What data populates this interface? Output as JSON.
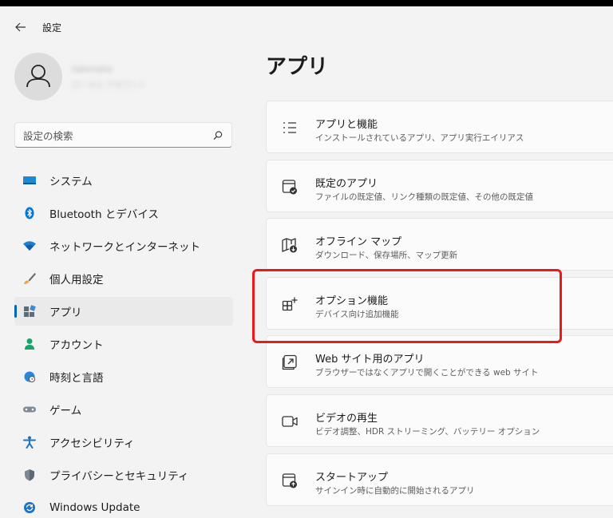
{
  "window": {
    "title": "設定"
  },
  "account": {
    "name": "takenaka",
    "email": "ローカル アカウント"
  },
  "search": {
    "placeholder": "設定の検索"
  },
  "nav": {
    "items": [
      {
        "label": "システム",
        "icon": "monitor-icon"
      },
      {
        "label": "Bluetooth とデバイス",
        "icon": "bluetooth-icon"
      },
      {
        "label": "ネットワークとインターネット",
        "icon": "wifi-icon"
      },
      {
        "label": "個人用設定",
        "icon": "brush-icon"
      },
      {
        "label": "アプリ",
        "icon": "apps-icon",
        "active": true
      },
      {
        "label": "アカウント",
        "icon": "person-icon"
      },
      {
        "label": "時刻と言語",
        "icon": "globe-clock-icon"
      },
      {
        "label": "ゲーム",
        "icon": "gamepad-icon"
      },
      {
        "label": "アクセシビリティ",
        "icon": "accessibility-icon"
      },
      {
        "label": "プライバシーとセキュリティ",
        "icon": "shield-icon"
      },
      {
        "label": "Windows Update",
        "icon": "update-icon"
      }
    ]
  },
  "main": {
    "title": "アプリ",
    "cards": [
      {
        "title": "アプリと機能",
        "desc": "インストールされているアプリ、アプリ実行エイリアス",
        "icon": "list-icon"
      },
      {
        "title": "既定のアプリ",
        "desc": "ファイルの既定値、リンク種類の既定値、その他の既定値",
        "icon": "default-apps-icon"
      },
      {
        "title": "オフライン マップ",
        "desc": "ダウンロード、保存場所、マップ更新",
        "icon": "map-icon"
      },
      {
        "title": "オプション機能",
        "desc": "デバイス向け追加機能",
        "icon": "add-feature-icon"
      },
      {
        "title": "Web サイト用のアプリ",
        "desc": "ブラウザーではなくアプリで開くことができる web サイト",
        "icon": "open-in-app-icon"
      },
      {
        "title": "ビデオの再生",
        "desc": "ビデオ調整、HDR ストリーミング、バッテリー オプション",
        "icon": "video-icon"
      },
      {
        "title": "スタートアップ",
        "desc": "サインイン時に自動的に開始されるアプリ",
        "icon": "startup-icon"
      }
    ]
  },
  "colors": {
    "accent": "#0067c0",
    "highlight": "#e81a1a",
    "background": "#f3f3f3"
  }
}
